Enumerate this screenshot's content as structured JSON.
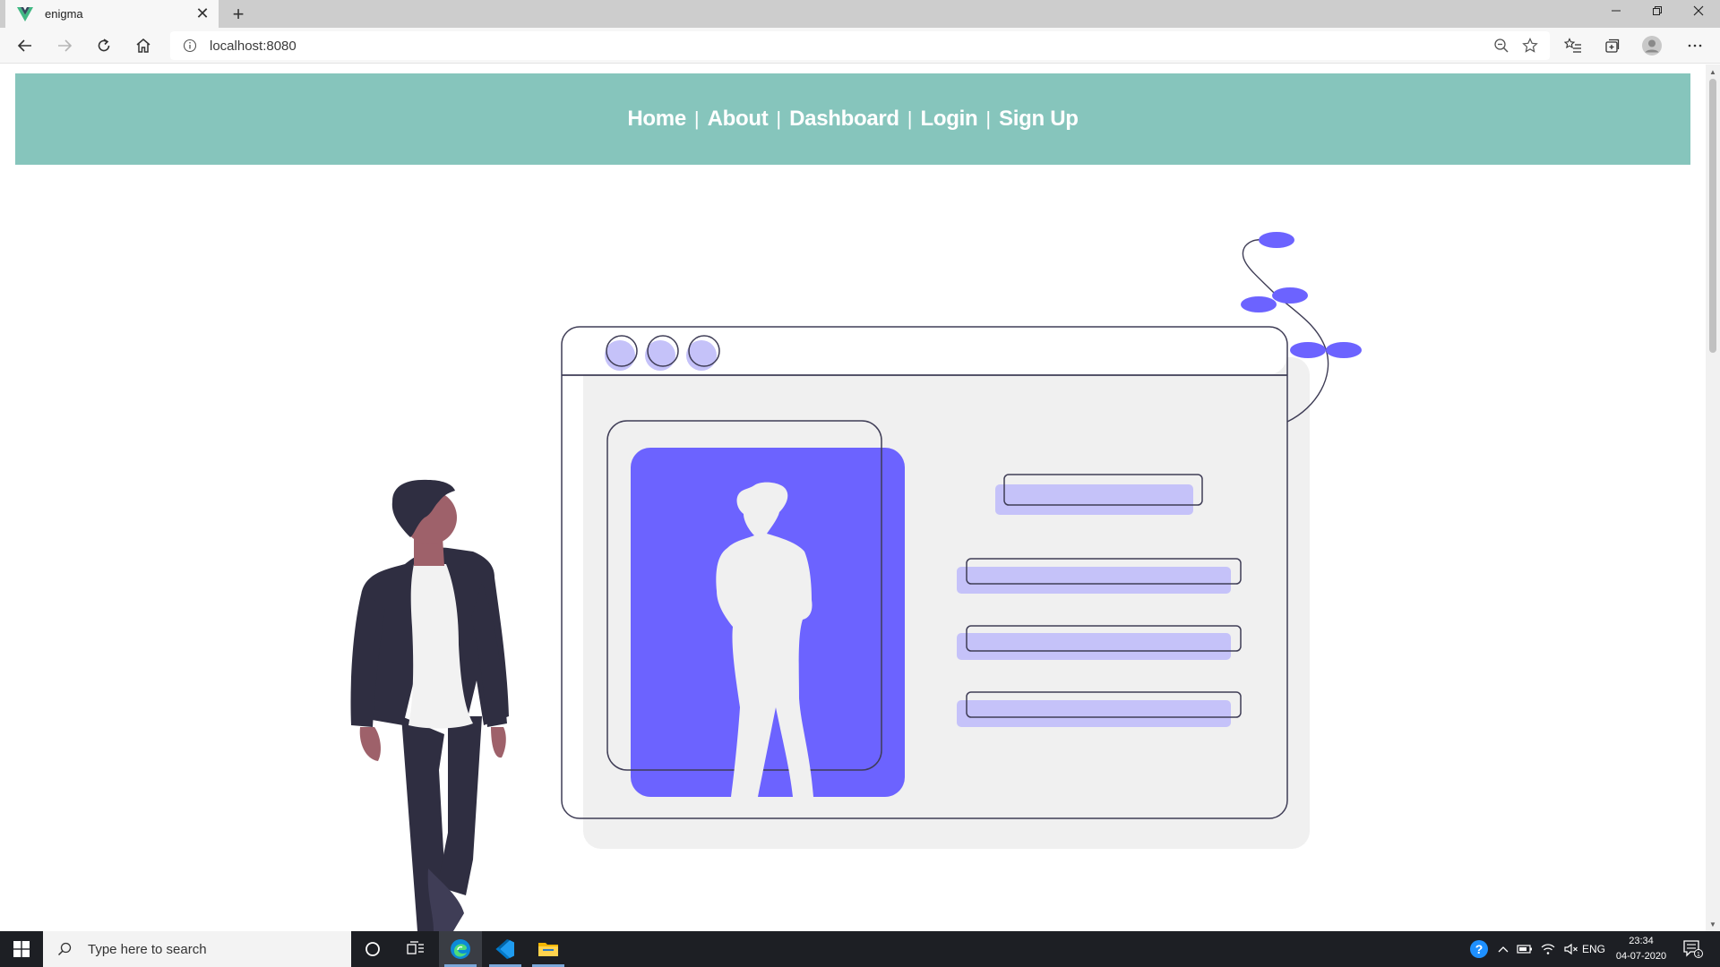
{
  "browser": {
    "tab_title": "enigma",
    "address": "localhost:8080",
    "new_tab_symbol": "+",
    "close_symbol": "✕"
  },
  "nav": {
    "links": [
      "Home",
      "About",
      "Dashboard",
      "Login",
      "Sign Up"
    ],
    "separator": "|",
    "bg_color": "#86c5bc"
  },
  "illustration": {
    "accent_color": "#6c63ff",
    "light_accent_color": "#c5c2f9",
    "panel_color": "#f0f0f0",
    "outline_color": "#3f3d56"
  },
  "taskbar": {
    "search_placeholder": "Type here to search",
    "language": "ENG",
    "time": "23:34",
    "date": "04-07-2020",
    "notification_count": "1"
  }
}
